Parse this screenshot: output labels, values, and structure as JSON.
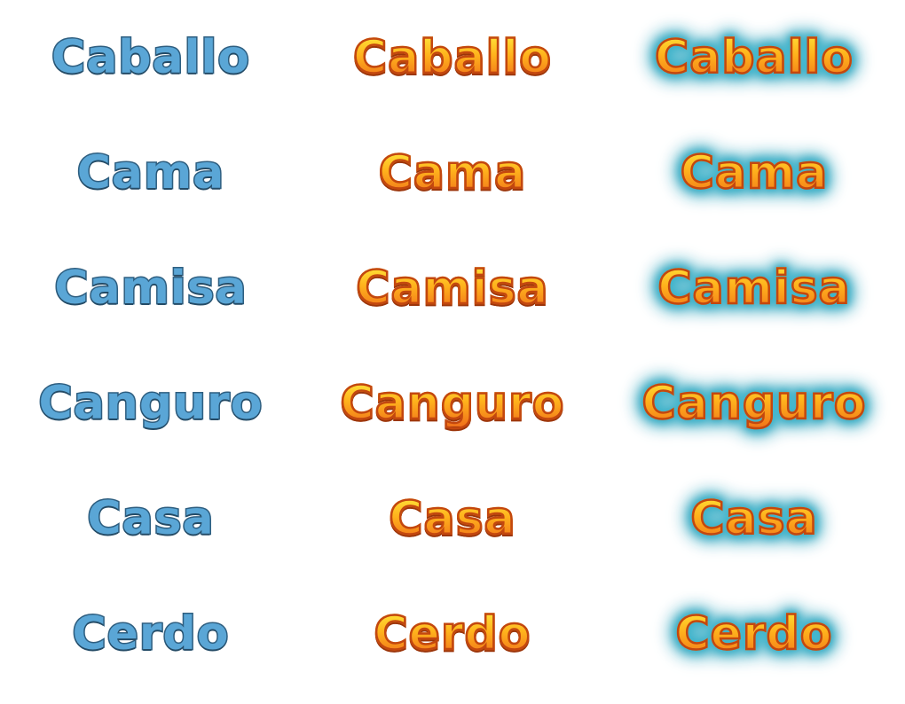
{
  "words": [
    "Caballo",
    "Cama",
    "Camisa",
    "Canguro",
    "Casa",
    "Cerdo"
  ],
  "colors": {
    "blue_fill": "#5aa6d6",
    "blue_outline": "#2f5f80",
    "orange_top": "#ffe63a",
    "orange_bottom": "#f0701a",
    "orange_outline": "#c3470f",
    "glow": "#3ab4cc"
  }
}
